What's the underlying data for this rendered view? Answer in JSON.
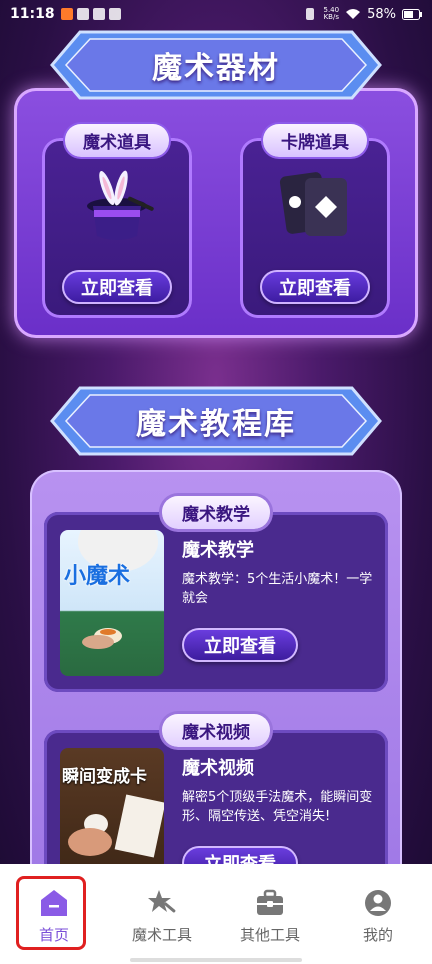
{
  "status_bar": {
    "time": "11:18",
    "net_speed_value": "5.40",
    "net_speed_unit": "KB/s",
    "battery": "58%"
  },
  "equipment_section": {
    "title": "魔术器材",
    "cards": [
      {
        "label": "魔术道具",
        "button": "立即查看",
        "icon": "magic-hat-icon"
      },
      {
        "label": "卡牌道具",
        "button": "立即查看",
        "icon": "playing-cards-icon"
      }
    ]
  },
  "tutorial_section": {
    "title": "魔术教程库",
    "items": [
      {
        "tag": "魔术教学",
        "title": "魔术教学",
        "description": "魔术教学：5个生活小魔术！一学就会",
        "button": "立即查看",
        "thumb_text": "小魔术"
      },
      {
        "tag": "魔术视频",
        "title": "魔术视频",
        "description": "解密5个顶级手法魔术，能瞬间变形、隔空传送、凭空消失!",
        "button": "立即查看",
        "thumb_text": "瞬间变成卡"
      }
    ]
  },
  "bottom_nav": {
    "items": [
      {
        "label": "首页",
        "icon": "home-icon",
        "active": true
      },
      {
        "label": "魔术工具",
        "icon": "magic-wand-icon",
        "active": false
      },
      {
        "label": "其他工具",
        "icon": "toolbox-icon",
        "active": false
      },
      {
        "label": "我的",
        "icon": "user-icon",
        "active": false
      }
    ]
  },
  "colors": {
    "accent": "#7b4fd8",
    "highlight_border": "#e02020"
  }
}
